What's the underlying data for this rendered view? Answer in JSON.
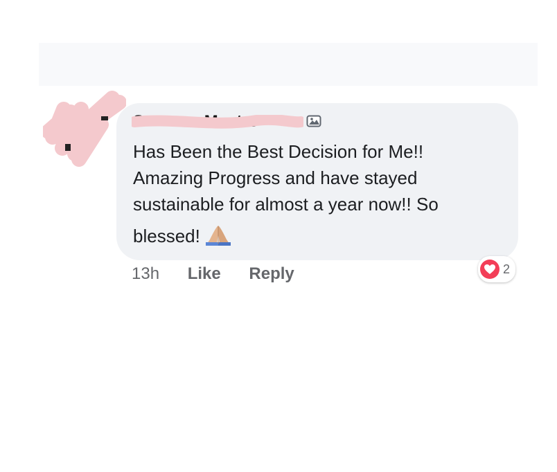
{
  "comment": {
    "author_name": "S–––––– M––tre",
    "text_lines": [
      "Has Been the Best Decision for Me!!",
      "Amazing Progress and have stayed",
      "sustainable for almost a year now!! So",
      "blessed!"
    ],
    "emoji": "folded-hands-emoji"
  },
  "actions": {
    "time": "13h",
    "like_label": "Like",
    "reply_label": "Reply"
  },
  "reactions": {
    "icon": "heart-icon",
    "count": "2",
    "color": "#f33e58"
  },
  "colors": {
    "bubble": "#f0f2f5",
    "redaction": "#f4c9cd",
    "secondary_text": "#65676b"
  }
}
